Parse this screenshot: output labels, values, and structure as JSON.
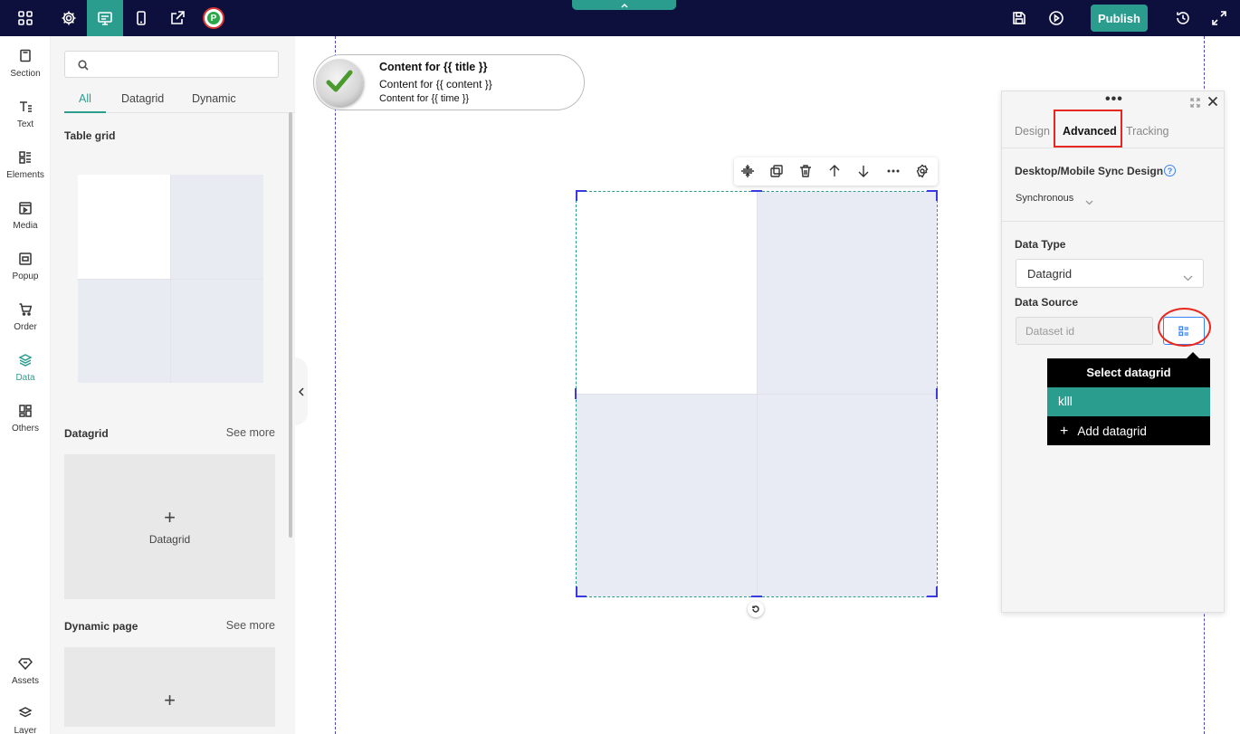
{
  "topbar": {
    "publish_label": "Publish",
    "logo_letter": "P",
    "icons": [
      "apps-grid-icon",
      "gear-icon",
      "desktop-icon",
      "mobile-icon",
      "share-icon",
      "save-icon",
      "play-icon",
      "history-icon",
      "fullscreen-icon"
    ]
  },
  "rail": {
    "items": [
      {
        "label": "Section",
        "icon": "section-icon"
      },
      {
        "label": "Text",
        "icon": "text-icon"
      },
      {
        "label": "Elements",
        "icon": "elements-icon"
      },
      {
        "label": "Media",
        "icon": "media-icon"
      },
      {
        "label": "Popup",
        "icon": "popup-icon"
      },
      {
        "label": "Order",
        "icon": "cart-icon"
      },
      {
        "label": "Data",
        "icon": "layers-icon",
        "active": true
      },
      {
        "label": "Others",
        "icon": "others-icon"
      },
      {
        "label": "Assets",
        "icon": "diamond-icon"
      },
      {
        "label": "Layer",
        "icon": "layer-stack-icon"
      }
    ]
  },
  "panel": {
    "search_placeholder": "",
    "tabs": [
      {
        "label": "All",
        "active": true
      },
      {
        "label": "Datagrid"
      },
      {
        "label": "Dynamic"
      }
    ],
    "table_grid_title": "Table grid",
    "datagrid_title": "Datagrid",
    "datagrid_see_more": "See more",
    "datagrid_add_label": "Datagrid",
    "dynamic_title": "Dynamic page",
    "dynamic_see_more": "See more",
    "plus": "+"
  },
  "canvas": {
    "notification": {
      "title": "Content for {{ title }}",
      "content": "Content for {{ content }}",
      "time": "Content for {{ time }}"
    },
    "toolbar_icons": [
      "align-icon",
      "duplicate-icon",
      "delete-icon",
      "move-up-icon",
      "move-down-icon",
      "more-icon",
      "settings-icon"
    ]
  },
  "settings": {
    "tabs": [
      {
        "label": "Design"
      },
      {
        "label": "Advanced",
        "active": true
      },
      {
        "label": "Tracking"
      }
    ],
    "sync_label": "Desktop/Mobile Sync Design",
    "sync_value": "Synchronous",
    "help_symbol": "?",
    "data_type_label": "Data Type",
    "data_type_value": "Datagrid",
    "data_source_label": "Data Source",
    "dataset_placeholder": "Dataset id",
    "dots": "•••"
  },
  "dropdown": {
    "title": "Select datagrid",
    "items": [
      "klll"
    ],
    "add_label": "Add datagrid",
    "plus": "+"
  },
  "colors": {
    "topbar_bg": "#0d0f3c",
    "accent": "#2a9d8f",
    "annotation_red": "#e8281e",
    "selection_blue": "#3a3ae0"
  }
}
